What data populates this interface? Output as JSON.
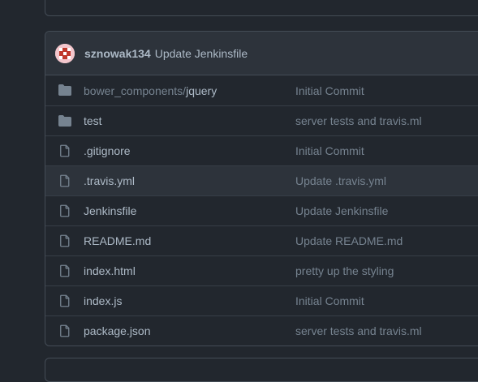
{
  "commit": {
    "author": "sznowak134",
    "message": "Update Jenkinsfile"
  },
  "files": [
    {
      "type": "dir-icon",
      "prefix": "bower_components/",
      "name": "jquery",
      "message": "Initial Commit"
    },
    {
      "type": "dir-icon",
      "prefix": "",
      "name": "test",
      "message": "server tests and travis.ml"
    },
    {
      "type": "file-icon",
      "prefix": "",
      "name": ".gitignore",
      "message": "Initial Commit"
    },
    {
      "type": "file-icon",
      "prefix": "",
      "name": ".travis.yml",
      "message": "Update .travis.yml"
    },
    {
      "type": "file-icon",
      "prefix": "",
      "name": "Jenkinsfile",
      "message": "Update Jenkinsfile"
    },
    {
      "type": "file-icon",
      "prefix": "",
      "name": "README.md",
      "message": "Update README.md"
    },
    {
      "type": "file-icon",
      "prefix": "",
      "name": "index.html",
      "message": "pretty up the styling"
    },
    {
      "type": "file-icon",
      "prefix": "",
      "name": "index.js",
      "message": "Initial Commit"
    },
    {
      "type": "file-icon",
      "prefix": "",
      "name": "package.json",
      "message": "server tests and travis.ml"
    }
  ],
  "colors": {
    "background": "#22272e",
    "border": "#444c56",
    "text": "#adbac7",
    "muted": "#768390"
  }
}
